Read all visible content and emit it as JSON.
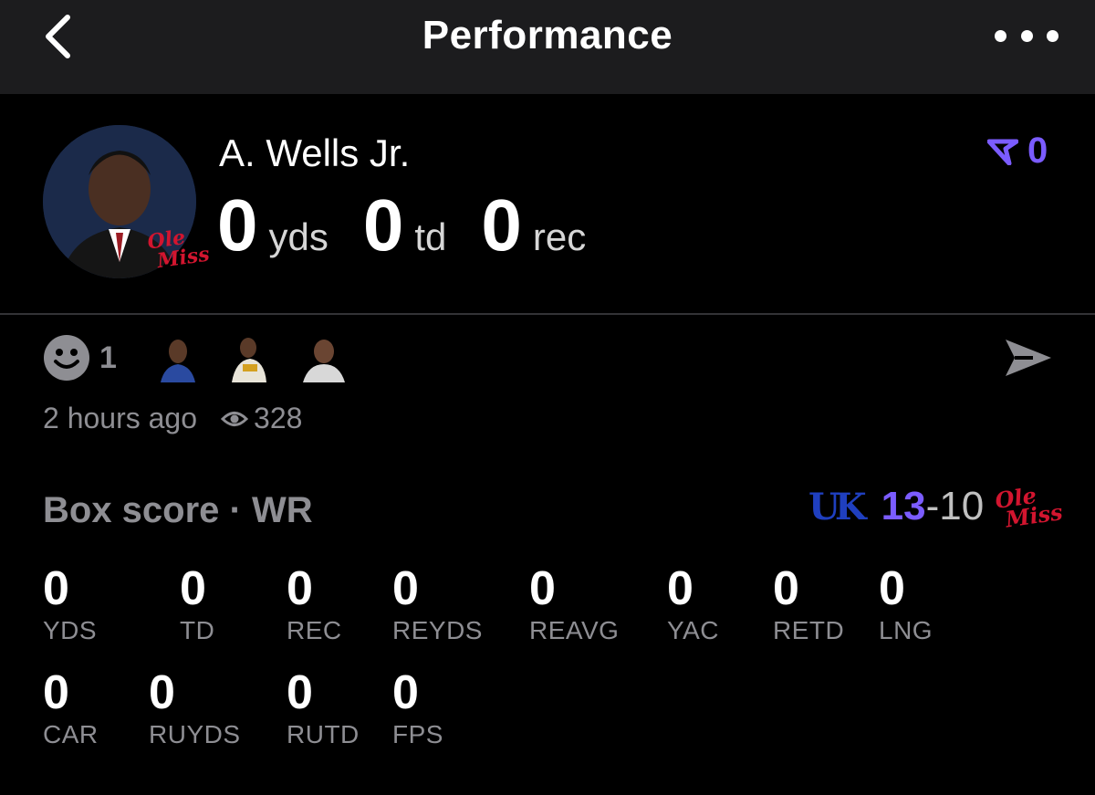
{
  "header": {
    "title": "Performance"
  },
  "player": {
    "name": "A. Wells Jr.",
    "team_logo_text": "Ole Miss",
    "stats": [
      {
        "value": "0",
        "unit": "yds"
      },
      {
        "value": "0",
        "unit": "td"
      },
      {
        "value": "0",
        "unit": "rec"
      }
    ],
    "picks_count": "0"
  },
  "social": {
    "reaction_count": "1",
    "time_ago": "2 hours ago",
    "views": "328"
  },
  "box_score": {
    "title": "Box score · WR",
    "home_team_logo": "UK",
    "home_score": "13",
    "separator": "-",
    "away_score": "10",
    "away_team_logo": "Ole Miss",
    "row1": [
      {
        "value": "0",
        "label": "YDS"
      },
      {
        "value": "0",
        "label": "TD"
      },
      {
        "value": "0",
        "label": "REC"
      },
      {
        "value": "0",
        "label": "REYDS"
      },
      {
        "value": "0",
        "label": "REAVG"
      },
      {
        "value": "0",
        "label": "YAC"
      },
      {
        "value": "0",
        "label": "RETD"
      },
      {
        "value": "0",
        "label": "LNG"
      }
    ],
    "row2": [
      {
        "value": "0",
        "label": "CAR"
      },
      {
        "value": "0",
        "label": "RUYDS"
      },
      {
        "value": "0",
        "label": "RUTD"
      },
      {
        "value": "0",
        "label": "FPS"
      }
    ]
  },
  "colors": {
    "accent": "#7b5cff",
    "ole_miss_red": "#d2152f",
    "uk_blue": "#1f3fbf",
    "muted": "#8e8e93",
    "header_bg": "#1c1c1e"
  }
}
